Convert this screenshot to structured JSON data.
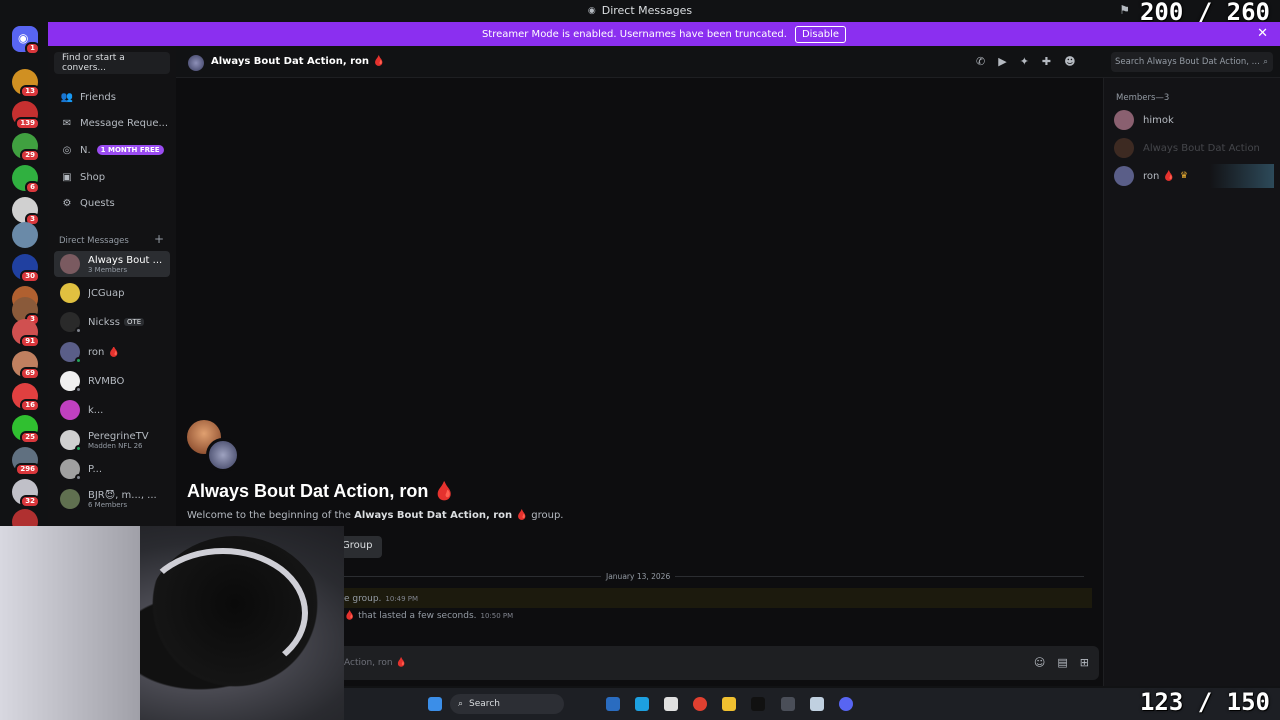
{
  "titlebar": {
    "title": "Direct Messages",
    "counter_top": "200 / 260"
  },
  "banner": {
    "text": "Streamer Mode is enabled. Usernames have been truncated.",
    "button": "Disable",
    "close": "✕"
  },
  "guild_badges": [
    "1",
    "13",
    "139",
    "29",
    "6",
    "3",
    "",
    "30",
    "",
    "3",
    "91",
    "69",
    "16",
    "25",
    "296",
    "32",
    ""
  ],
  "sidebar": {
    "search_placeholder": "Find or start a convers...",
    "nav": [
      {
        "label": "Friends",
        "icon": "👥"
      },
      {
        "label": "Message Reque...",
        "icon": "✉"
      },
      {
        "label": "N.",
        "icon": "◎",
        "promo": "1 MONTH FREE"
      },
      {
        "label": "Shop",
        "icon": "▣"
      },
      {
        "label": "Quests",
        "icon": "⚙"
      }
    ],
    "dm_header": "Direct Messages",
    "dm_add": "+",
    "dms": [
      {
        "name": "Always Bout ...",
        "sub": "3 Members",
        "active": true
      },
      {
        "name": "JCGuap",
        "sub": ""
      },
      {
        "name": "Nickss",
        "sub": "",
        "tag": "OTE"
      },
      {
        "name": "ron 🩸",
        "sub": ""
      },
      {
        "name": "RVMBO",
        "sub": ""
      },
      {
        "name": "k...",
        "sub": ""
      },
      {
        "name": "PeregrineTV",
        "sub": "Madden NFL 26"
      },
      {
        "name": "P...",
        "sub": ""
      },
      {
        "name": "BJR😈, m..., ...",
        "sub": "6 Members"
      }
    ]
  },
  "header": {
    "channel": "Always Bout Dat Action, ron 🩸",
    "search_placeholder": "Search Always Bout Dat Action, ..."
  },
  "welcome": {
    "title": "Always Bout Dat Action, ron 🩸",
    "prefix": "Welcome to the beginning of the ",
    "bold": "Always Bout Dat Action, ron 🩸",
    "suffix": " group.",
    "button": "Group"
  },
  "messages": {
    "date": "January 13, 2026",
    "msg1": "e group.",
    "msg1_time": "10:49 PM",
    "msg2": "🩸  that lasted a few seconds.",
    "msg2_time": "10:50 PM"
  },
  "input": {
    "placeholder": "Action, ron 🩸"
  },
  "members": {
    "header": "Members—3",
    "list": [
      {
        "name": "himok",
        "crown": ""
      },
      {
        "name": "Always Bout Dat Action",
        "crown": ""
      },
      {
        "name": "ron 🩸",
        "crown": "♛"
      }
    ]
  },
  "taskbar": {
    "search": "Search",
    "counter_bottom": "123 / 150"
  }
}
